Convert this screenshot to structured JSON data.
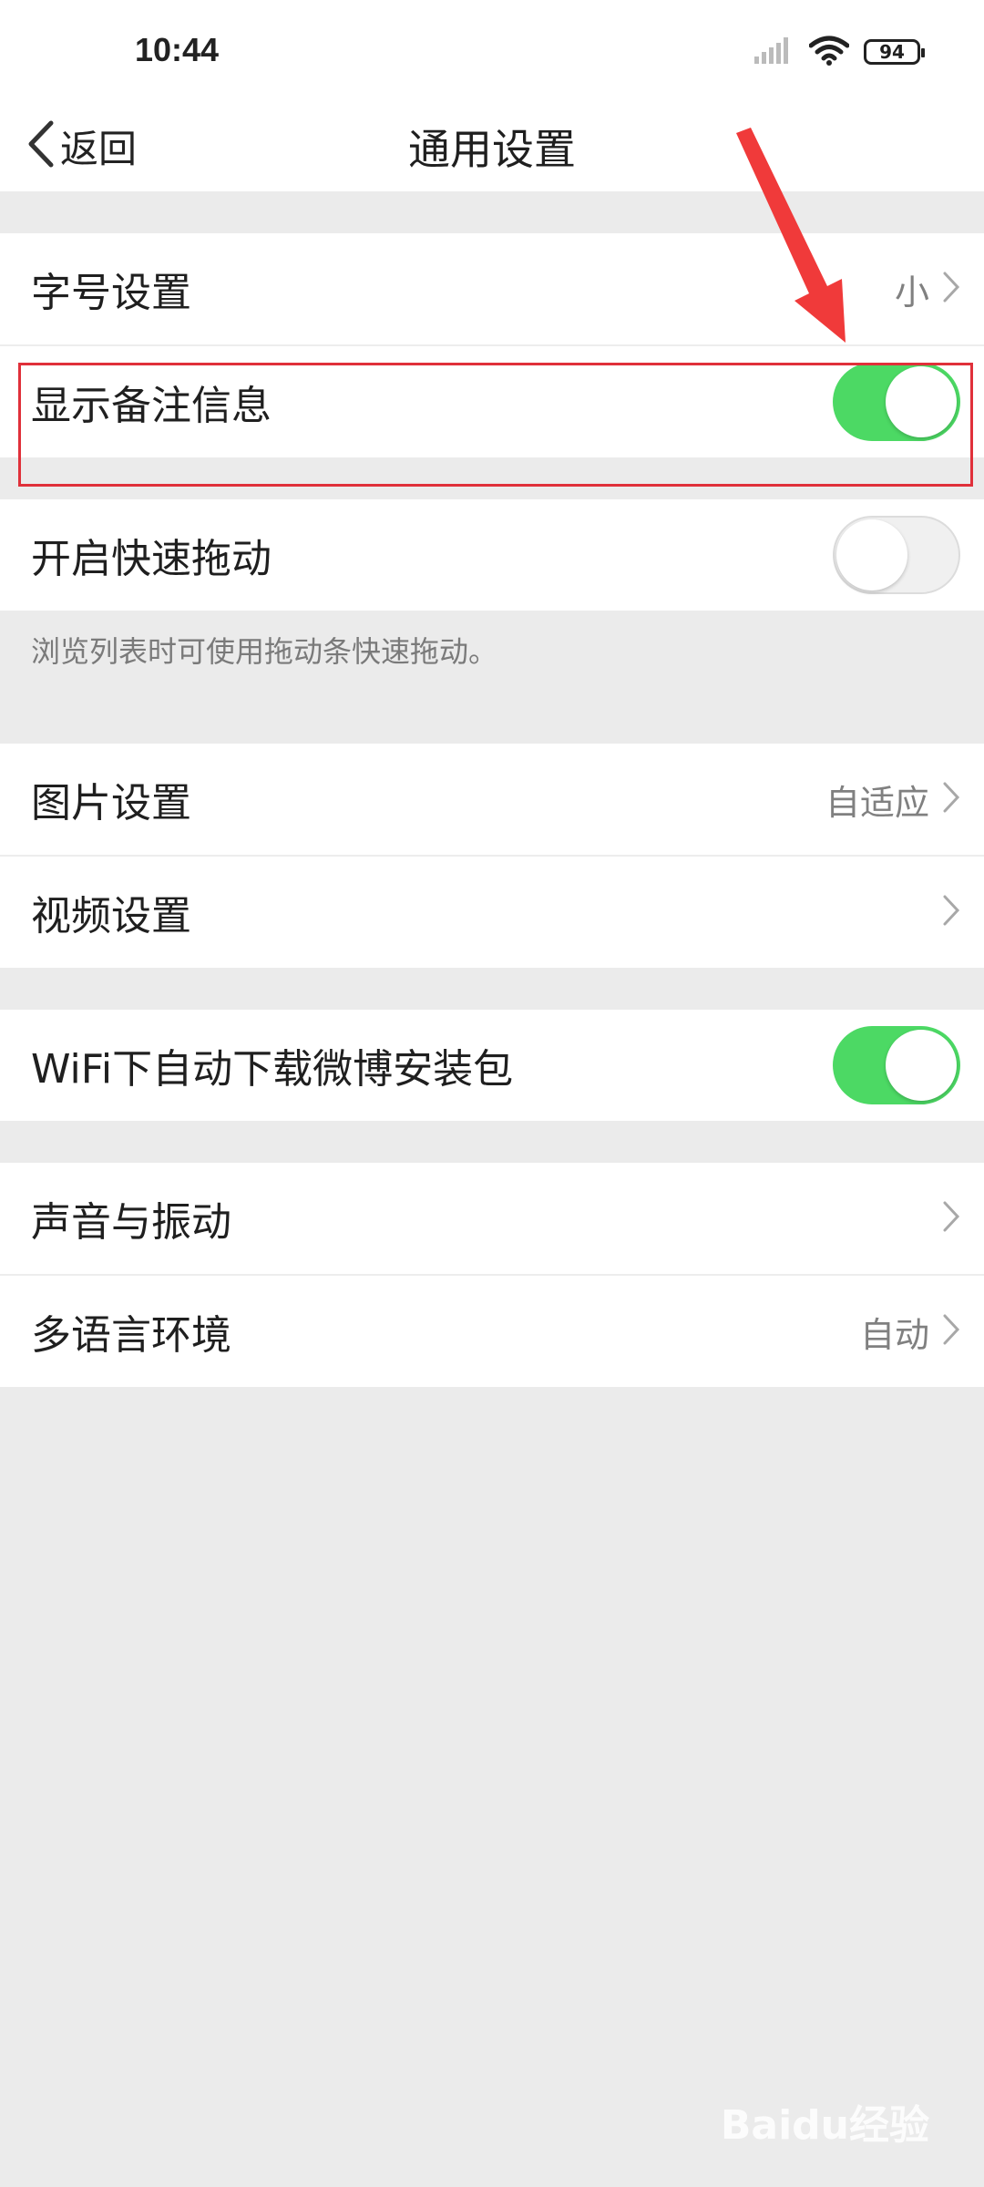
{
  "status": {
    "time": "10:44",
    "battery": "94"
  },
  "nav": {
    "back_label": "返回",
    "title": "通用设置"
  },
  "rows": {
    "font_size": {
      "label": "字号设置",
      "value": "小"
    },
    "show_remark": {
      "label": "显示备注信息",
      "state": "on"
    },
    "fast_drag": {
      "label": "开启快速拖动",
      "state": "off",
      "hint": "浏览列表时可使用拖动条快速拖动。"
    },
    "image": {
      "label": "图片设置",
      "value": "自适应"
    },
    "video": {
      "label": "视频设置"
    },
    "wifi_download": {
      "label": "WiFi下自动下载微博安装包",
      "state": "on"
    },
    "sound": {
      "label": "声音与振动"
    },
    "language": {
      "label": "多语言环境",
      "value": "自动"
    }
  },
  "watermark": "Baidu经验",
  "colors": {
    "toggle_on": "#4cd964",
    "annotation": "#e0303a"
  }
}
